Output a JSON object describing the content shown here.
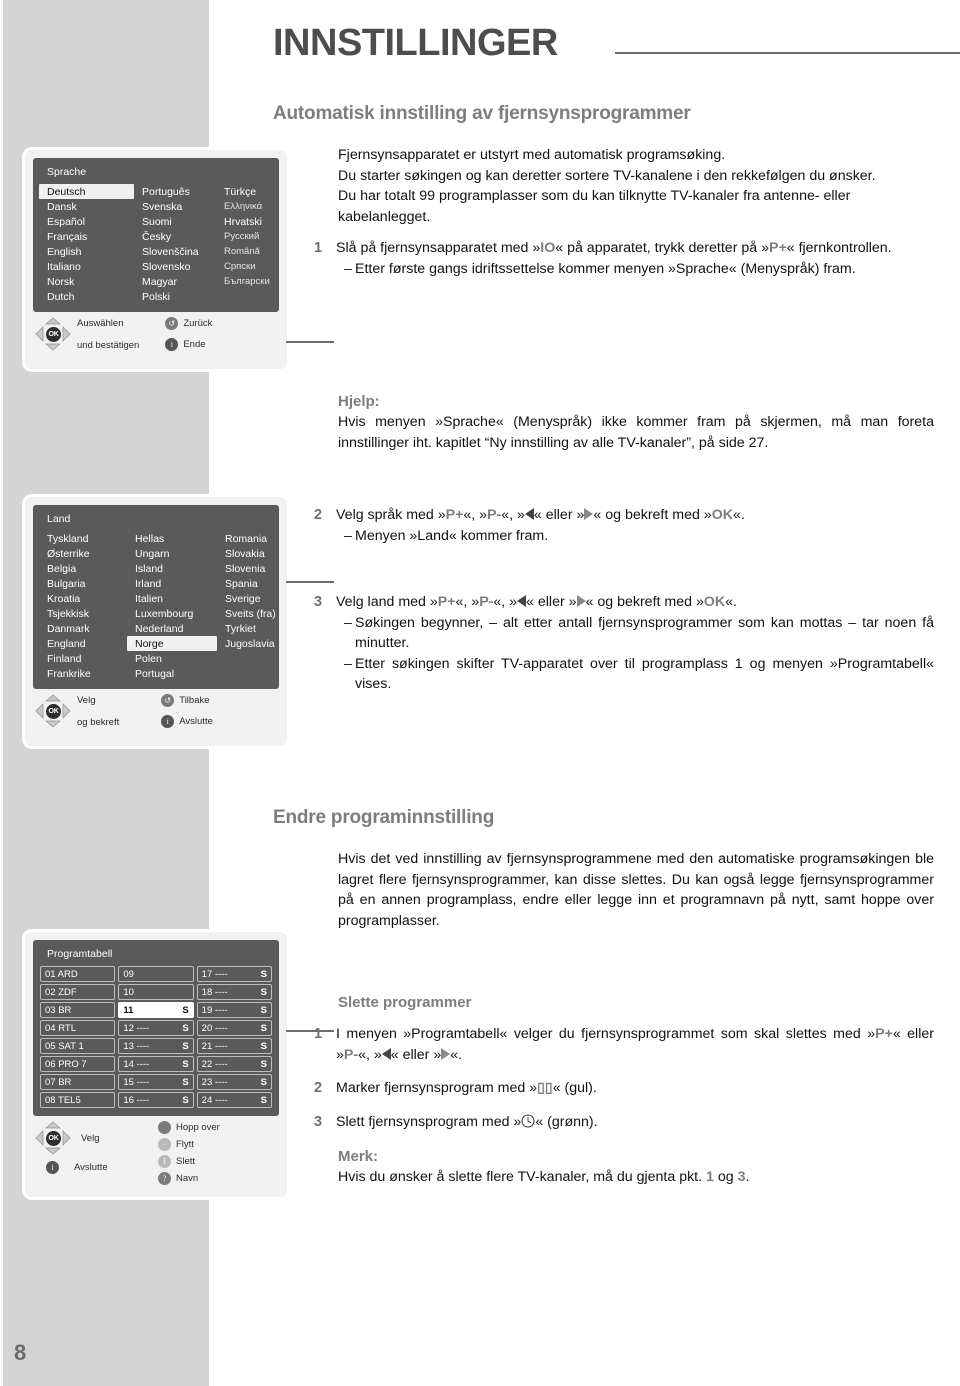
{
  "page": {
    "number": "8"
  },
  "header": {
    "chapter_title": "INNSTILLINGER",
    "section_title": "Automatisk innstilling av fjernsynsprogrammer"
  },
  "intro": {
    "lines": [
      "Fjernsynsapparatet er utstyrt med automatisk programsøking.",
      "Du starter søkingen og kan deretter sortere TV-kanalene i den rekkefølgen du ønsker.",
      "Du har totalt 99 programplasser som du kan tilknytte TV-kanaler fra antenne- eller kabelanlegget."
    ]
  },
  "steps_main": [
    {
      "no": "1",
      "text_a": "Slå på fjernsynsapparatet med »",
      "key_a": "IO",
      "text_b": "« på apparatet, trykk deretter på »",
      "key_b": "P+",
      "text_c": "« fjernkontrollen.",
      "sub": "Etter første gangs idriftssettelse kommer menyen »Sprache« (Menyspråk) fram."
    }
  ],
  "help": {
    "title": "Hjelp:",
    "text": "Hvis menyen »Sprache« (Menyspråk) ikke kommer fram på skjermen, må man foreta innstillinger iht. kapitlet “Ny innstilling av alle TV-kanaler”, på side 27."
  },
  "step2": {
    "no": "2",
    "text_a": "Velg språk med »",
    "k1": "P+",
    "t1": "«, »",
    "k2": "P-",
    "t2": "«, »",
    "t3": "« eller »",
    "t4": "« og bekreft med »",
    "k3": "OK",
    "t5": "«.",
    "sub": "Menyen »Land« kommer fram."
  },
  "step3": {
    "no": "3",
    "text_a": "Velg land med »",
    "k1": "P+",
    "t1": "«, »",
    "k2": "P-",
    "t2": "«, »",
    "t3": "« eller »",
    "t4": "« og bekreft med »",
    "k3": "OK",
    "t5": "«.",
    "sub1": "Søkingen begynner, – alt etter antall fjernsynsprogrammer som kan mottas – tar noen få minutter.",
    "sub2": "Etter søkingen skifter TV-apparatet over til programplass 1 og menyen »Programtabell« vises."
  },
  "section2": {
    "title": "Endre programinnstilling",
    "paragraph": "Hvis det ved innstilling av fjernsynsprogrammene med den automatiske programsøkingen ble lagret flere fjernsynsprogrammer, kan disse slettes. Du kan også legge fjernsynsprogrammer på en annen programplass, endre eller legge inn et programnavn på nytt, samt hoppe over programplasser.",
    "subtitle": "Slette programmer",
    "steps": [
      {
        "no": "1",
        "a": "I menyen »Programtabell« velger du fjernsynsprogrammet som skal slettes med »",
        "k1": "P+",
        "b": "« eller »",
        "k2": "P-",
        "c": "«, »",
        "d": "« eller »",
        "e": "«."
      },
      {
        "no": "2",
        "a": "Marker fjernsynsprogram med »",
        "icon": "yellow-bars-icon",
        "b": "« (gul)."
      },
      {
        "no": "3",
        "a": "Slett fjernsynsprogram med »",
        "icon": "green-clock-icon",
        "b": "« (grønn)."
      }
    ],
    "note_title": "Merk:",
    "note_a": "Hvis du ønsker å slette flere TV-kanaler, må du gjenta pkt. ",
    "note_k1": "1",
    "note_b": " og ",
    "note_k2": "3",
    "note_c": "."
  },
  "osd_sprache": {
    "title": "Sprache",
    "col1": [
      "Deutsch",
      "Dansk",
      "Español",
      "Français",
      "English",
      "Italiano",
      "Norsk",
      "Dutch"
    ],
    "col2": [
      "Português",
      "Svenska",
      "Suomi",
      "Česky",
      "Slovenščina",
      "Slovensko",
      "Magyar",
      "Polski"
    ],
    "col3": [
      "Türkçe",
      "Ελληνικά",
      "Hrvatski",
      "Русский",
      "Română",
      "Српски",
      "Български",
      ""
    ],
    "selected": "Deutsch",
    "faint_col3": [
      "Ελληνικά",
      "Русский",
      "Română",
      "Српски",
      "Български"
    ],
    "footer": {
      "nav_line1": "Auswählen",
      "nav_line2": "und bestätigen",
      "back_label": "Zurück",
      "back_icon": "return-arrow-icon",
      "end_label": "Ende",
      "end_icon": "info-icon",
      "ok_label": "OK"
    }
  },
  "osd_land": {
    "title": "Land",
    "col1": [
      "Tyskland",
      "Østerrike",
      "Belgia",
      "Bulgaria",
      "Kroatia",
      "Tsjekkisk",
      "Danmark",
      "England",
      "Finland",
      "Frankrike"
    ],
    "col2": [
      "Hellas",
      "Ungarn",
      "Island",
      "Irland",
      "Italien",
      "Luxembourg",
      "Nederland",
      "Norge",
      "Polen",
      "Portugal"
    ],
    "col3": [
      "Romania",
      "Slovakia",
      "Slovenia",
      "Spania",
      "Sverige",
      "Sveits (fra)",
      "Tyrkiet",
      "Jugoslavia",
      "",
      ""
    ],
    "selected": "Norge",
    "footer": {
      "nav_line1": "Velg",
      "nav_line2": "og bekreft",
      "back_label": "Tilbake",
      "back_icon": "return-arrow-icon",
      "end_label": "Avslutte",
      "end_icon": "info-icon",
      "ok_label": "OK"
    }
  },
  "osd_programtabell": {
    "title": "Programtabell",
    "cells": [
      {
        "label": "01 ARD",
        "s": "",
        "sel": false
      },
      {
        "label": "09",
        "s": "",
        "sel": false
      },
      {
        "label": "17 ----",
        "s": "S",
        "sel": false
      },
      {
        "label": "02 ZDF",
        "s": "",
        "sel": false
      },
      {
        "label": "10",
        "s": "",
        "sel": false
      },
      {
        "label": "18 ----",
        "s": "S",
        "sel": false
      },
      {
        "label": "03 BR",
        "s": "",
        "sel": false
      },
      {
        "label": "11",
        "s": "S",
        "sel": true
      },
      {
        "label": "19 ----",
        "s": "S",
        "sel": false
      },
      {
        "label": "04 RTL",
        "s": "",
        "sel": false
      },
      {
        "label": "12 ----",
        "s": "S",
        "sel": false
      },
      {
        "label": "20 ----",
        "s": "S",
        "sel": false
      },
      {
        "label": "05 SAT 1",
        "s": "",
        "sel": false
      },
      {
        "label": "13 ----",
        "s": "S",
        "sel": false
      },
      {
        "label": "21 ----",
        "s": "S",
        "sel": false
      },
      {
        "label": "06 PRO 7",
        "s": "",
        "sel": false
      },
      {
        "label": "14 ----",
        "s": "S",
        "sel": false
      },
      {
        "label": "22 ----",
        "s": "S",
        "sel": false
      },
      {
        "label": "07 BR",
        "s": "",
        "sel": false
      },
      {
        "label": "15 ----",
        "s": "S",
        "sel": false
      },
      {
        "label": "23 ----",
        "s": "S",
        "sel": false
      },
      {
        "label": "08 TEL5",
        "s": "",
        "sel": false
      },
      {
        "label": "16 ----",
        "s": "S",
        "sel": false
      },
      {
        "label": "24 ----",
        "s": "S",
        "sel": false
      }
    ],
    "footer": {
      "nav_label": "Velg",
      "exit_label": "Avslutte",
      "exit_icon": "info-icon",
      "ok_label": "OK",
      "actions": [
        {
          "label": "Hopp over",
          "icon": "blue-oval-icon"
        },
        {
          "label": "Flytt",
          "icon": "grey-circle-icon"
        },
        {
          "label": "Slett",
          "icon": "pause-bars-icon"
        },
        {
          "label": "Navn",
          "icon": "question-circle-icon"
        }
      ]
    }
  },
  "colors": {
    "panel_bg": "#5a5a5a",
    "panel_frame": "#f1f1f1",
    "strip_bg": "#d4d4d4",
    "heading_gray": "#7d7d7d",
    "rule_gray": "#6d6d6d"
  }
}
